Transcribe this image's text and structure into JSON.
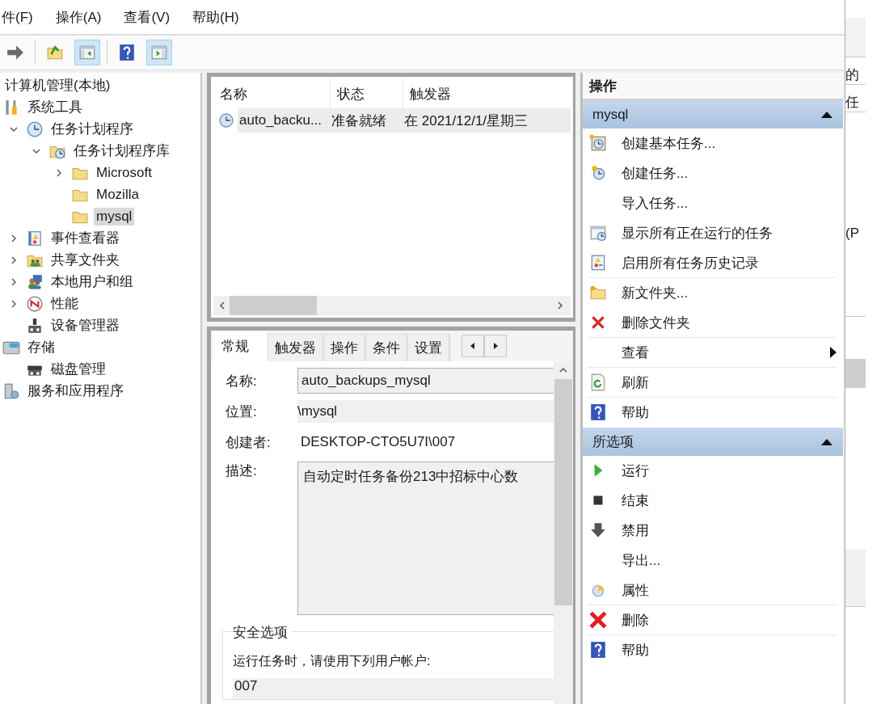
{
  "menu": [
    {
      "label": "件(F)"
    },
    {
      "label": "操作(A)"
    },
    {
      "label": "查看(V)"
    },
    {
      "label": "帮助(H)"
    }
  ],
  "toolbar": [
    {
      "kind": "forward",
      "pressed": false
    },
    {
      "kind": "up",
      "pressed": false
    },
    {
      "kind": "tree",
      "pressed": true
    },
    {
      "kind": "help",
      "pressed": false
    },
    {
      "kind": "actions",
      "pressed": true
    }
  ],
  "tree": [
    {
      "label": "计算机管理(本地)",
      "selected": false,
      "children": [
        {
          "label": "系统工具",
          "kind": "tools",
          "selected": false,
          "children": [
            {
              "label": "任务计划程序",
              "kind": "clock",
              "expanded": true,
              "selected": false,
              "children": [
                {
                  "label": "任务计划程序库",
                  "kind": "folder-clock",
                  "expanded": true,
                  "selected": false,
                  "children": [
                    {
                      "label": "Microsoft",
                      "kind": "folder",
                      "expanded": false,
                      "selected": false
                    },
                    {
                      "label": "Mozilla",
                      "kind": "folder",
                      "selected": false
                    },
                    {
                      "label": "mysql",
                      "kind": "folder",
                      "selected": true
                    }
                  ]
                }
              ]
            },
            {
              "label": "事件查看器",
              "kind": "log",
              "expanded": false,
              "selected": false
            },
            {
              "label": "共享文件夹",
              "kind": "share",
              "expanded": false,
              "selected": false
            },
            {
              "label": "本地用户和组",
              "kind": "users",
              "expanded": false,
              "selected": false
            },
            {
              "label": "性能",
              "kind": "gauge",
              "expanded": false,
              "selected": false
            },
            {
              "label": "设备管理器",
              "kind": "device",
              "selected": false
            }
          ]
        },
        {
          "label": "存储",
          "kind": "storage",
          "selected": false,
          "children": [
            {
              "label": "磁盘管理",
              "kind": "disk",
              "selected": false
            }
          ]
        },
        {
          "label": "服务和应用程序",
          "kind": "services",
          "selected": false
        }
      ]
    }
  ],
  "task_list": {
    "columns": [
      "名称",
      "状态",
      "触发器"
    ],
    "rows": [
      {
        "cells": [
          "auto_backu...",
          "准备就绪",
          "在 2021/12/1/星期三"
        ],
        "selected": true
      }
    ]
  },
  "tabs": [
    {
      "label": "常规",
      "selected": true
    },
    {
      "label": "触发器",
      "selected": false
    },
    {
      "label": "操作",
      "selected": false
    },
    {
      "label": "条件",
      "selected": false
    },
    {
      "label": "设置",
      "selected": false
    }
  ],
  "general": {
    "name_label": "名称:",
    "name": "auto_backups_mysql",
    "location_label": "位置:",
    "location": "\\mysql",
    "author_label": "创建者:",
    "author": "DESKTOP-CTO5U7I\\007",
    "description_label": "描述:",
    "description": "自动定时任务备份213中招标中心数",
    "security": {
      "title": "安全选项",
      "prompt": "运行任务时，请使用下列用户帐户:",
      "account": "007"
    }
  },
  "actions": {
    "title": "操作",
    "sections": [
      {
        "title": "mysql",
        "expanded": true,
        "items": [
          {
            "label": "创建基本任务...",
            "kind": "basic-task",
            "separator": false,
            "submenu": false
          },
          {
            "label": "创建任务...",
            "kind": "new-task",
            "separator": false,
            "submenu": false
          },
          {
            "label": "导入任务...",
            "kind": "plain",
            "separator": false,
            "submenu": false
          },
          {
            "label": "显示所有正在运行的任务",
            "kind": "running",
            "separator": false,
            "submenu": false
          },
          {
            "label": "启用所有任务历史记录",
            "kind": "history",
            "separator": true,
            "submenu": false
          },
          {
            "label": "新文件夹...",
            "kind": "new-folder",
            "separator": false,
            "submenu": false
          },
          {
            "label": "删除文件夹",
            "kind": "delete-small",
            "separator": true,
            "submenu": false
          },
          {
            "label": "查看",
            "kind": "plain",
            "separator": true,
            "submenu": true
          },
          {
            "label": "刷新",
            "kind": "refresh",
            "separator": true,
            "submenu": false
          },
          {
            "label": "帮助",
            "kind": "help",
            "separator": false,
            "submenu": false
          }
        ]
      },
      {
        "title": "所选项",
        "expanded": true,
        "items": [
          {
            "label": "运行",
            "kind": "play",
            "separator": false,
            "submenu": false
          },
          {
            "label": "结束",
            "kind": "stop",
            "separator": false,
            "submenu": false
          },
          {
            "label": "禁用",
            "kind": "down",
            "separator": false,
            "submenu": false
          },
          {
            "label": "导出...",
            "kind": "plain",
            "separator": false,
            "submenu": false
          },
          {
            "label": "属性",
            "kind": "properties",
            "separator": true,
            "submenu": false
          },
          {
            "label": "删除",
            "kind": "delete",
            "separator": true,
            "submenu": false
          },
          {
            "label": "帮助",
            "kind": "help",
            "separator": false,
            "submenu": false
          }
        ]
      }
    ]
  },
  "background_window": {
    "texts": [
      "的",
      "任",
      "(P"
    ]
  }
}
